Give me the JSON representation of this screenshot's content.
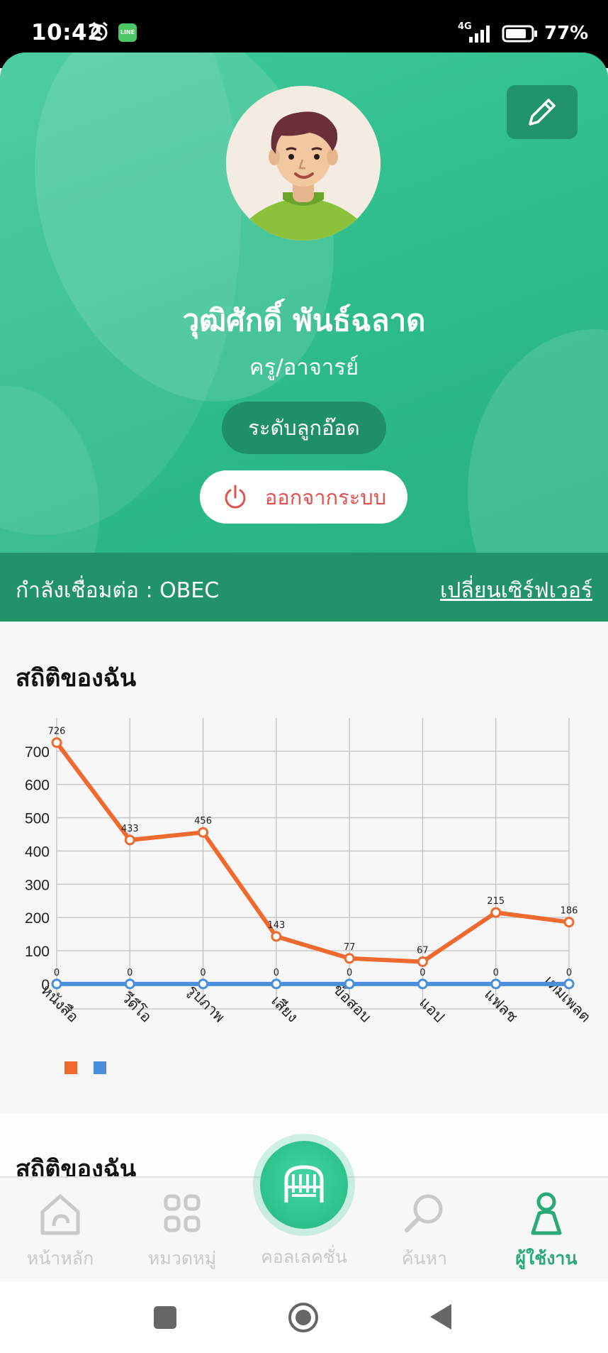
{
  "status_bar": {
    "time": "10:42",
    "network": "4G",
    "battery": "77%"
  },
  "profile": {
    "name": "วุฒิศักดิ์ พันธ์ฉลาด",
    "role": "ครู/อาจารย์",
    "level": "ระดับลูกอ๊อด",
    "logout_label": "ออกจากระบบ",
    "server_label": "กำลังเชื่อมต่อ : OBEC",
    "server_change": "เปลี่ยนเซิร์ฟเวอร์"
  },
  "stats": {
    "title": "สถิติของฉัน",
    "second_title": "สถิติของฉัน"
  },
  "chart_data": {
    "type": "line",
    "categories": [
      "หนังสือ",
      "วีดีโอ",
      "รูปภาพ",
      "เสียง",
      "ข้อสอบ",
      "แอป",
      "แฟลช",
      "เทมเพลต"
    ],
    "series": [
      {
        "values": [
          726,
          433,
          456,
          143,
          77,
          67,
          215,
          186
        ],
        "color": "#ee6a2f"
      },
      {
        "values": [
          0,
          0,
          0,
          0,
          0,
          0,
          0,
          0
        ],
        "color": "#4a8fdc"
      }
    ],
    "yticks": [
      0,
      100,
      200,
      300,
      400,
      500,
      600,
      700
    ],
    "ylim": [
      -75,
      800
    ],
    "grid": true,
    "legend": "bottom-left"
  },
  "nav": {
    "items": [
      {
        "label": "หน้าหลัก",
        "icon": "home-icon",
        "active": false
      },
      {
        "label": "หมวดหมู่",
        "icon": "category-icon",
        "active": false
      },
      {
        "label": "คอลเลคชั่น",
        "icon": "collection-icon",
        "active": false
      },
      {
        "label": "ค้นหา",
        "icon": "search-icon",
        "active": false
      },
      {
        "label": "ผู้ใช้งาน",
        "icon": "user-icon",
        "active": true
      }
    ],
    "accent": "#2aaa78",
    "inactive": "#c9c9c9"
  }
}
